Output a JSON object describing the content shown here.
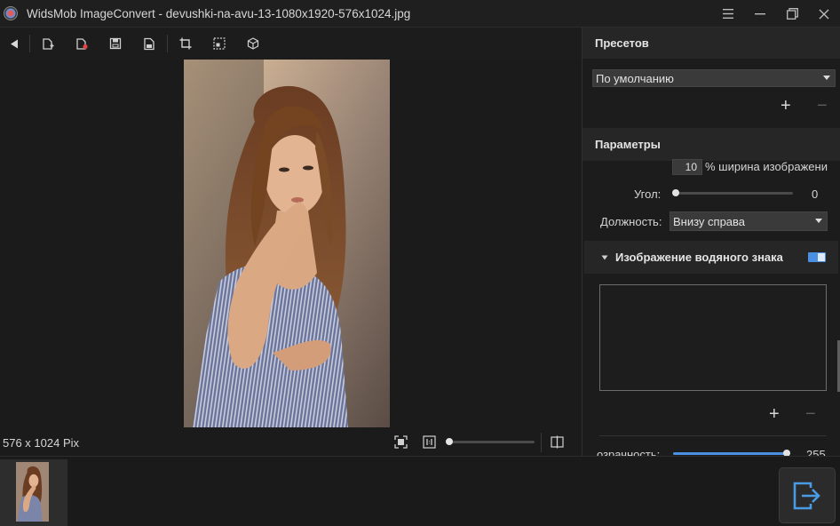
{
  "window": {
    "title": "WidsMob ImageConvert - devushki-na-avu-13-1080x1920-576x1024.jpg",
    "controls": [
      "menu-icon",
      "minimize-icon",
      "restore-icon",
      "close-icon"
    ]
  },
  "toolbar": {
    "buttons": [
      "back-icon",
      "add-file-icon",
      "remove-file-icon",
      "save-icon",
      "save-as-icon",
      "crop-icon",
      "resize-icon",
      "watermark-icon"
    ]
  },
  "status": {
    "dimensions": "576 x 1024 Pix",
    "zoom_percent": 0
  },
  "presets": {
    "header": "Пресетов",
    "selected": "По умолчанию",
    "add_label": "+",
    "remove_label": "−"
  },
  "params": {
    "header": "Параметры",
    "width_value": "10",
    "width_suffix": "% ширина изображени",
    "angle_label": "Угол:",
    "angle_value": "0",
    "position_label": "Должность:",
    "position_value": "Внизу справа",
    "watermark_section": "Изображение водяного знака",
    "watermark_enabled": true,
    "add_label": "+",
    "remove_label": "−",
    "opacity_label": "озрачность:",
    "opacity_value": "255"
  },
  "colors": {
    "accent": "#4a90e2",
    "background": "#1b1b1b",
    "panel": "#1c1c1c",
    "section": "#262626"
  }
}
